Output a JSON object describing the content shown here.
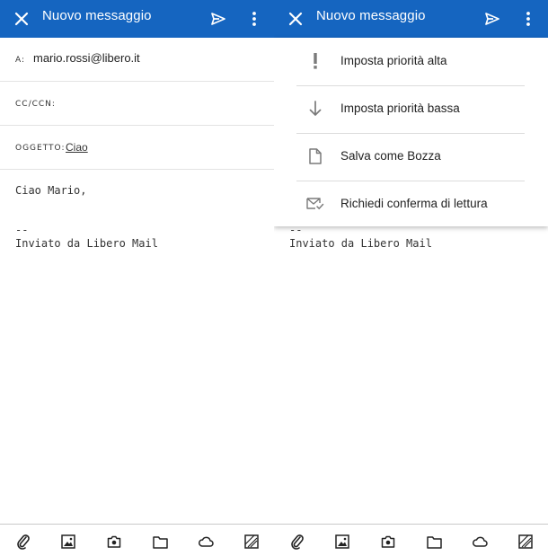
{
  "colors": {
    "appbar": "#1565c0",
    "icon": "#222222",
    "menu_icon": "#7a7a7a"
  },
  "compose": {
    "title": "Nuovo messaggio",
    "to_label": "A:",
    "to_value": "mario.rossi@libero.it",
    "cc_label": "CC/CCN:",
    "subject_label": "OGGETTO:",
    "subject_value": "Ciao",
    "greeting": "Ciao Mario,",
    "sig_sep": "--",
    "signature": "Inviato da Libero Mail"
  },
  "menu": {
    "items": [
      {
        "icon": "exclamation-icon",
        "label": "Imposta priorità alta"
      },
      {
        "icon": "arrow-down-icon",
        "label": "Imposta priorità bassa"
      },
      {
        "icon": "document-icon",
        "label": "Salva come Bozza"
      },
      {
        "icon": "envelope-check-icon",
        "label": "Richiedi conferma di lettura"
      }
    ]
  },
  "toolbar_icons": [
    "paperclip-icon",
    "image-icon",
    "camera-icon",
    "folder-icon",
    "cloud-icon",
    "sketch-icon"
  ]
}
